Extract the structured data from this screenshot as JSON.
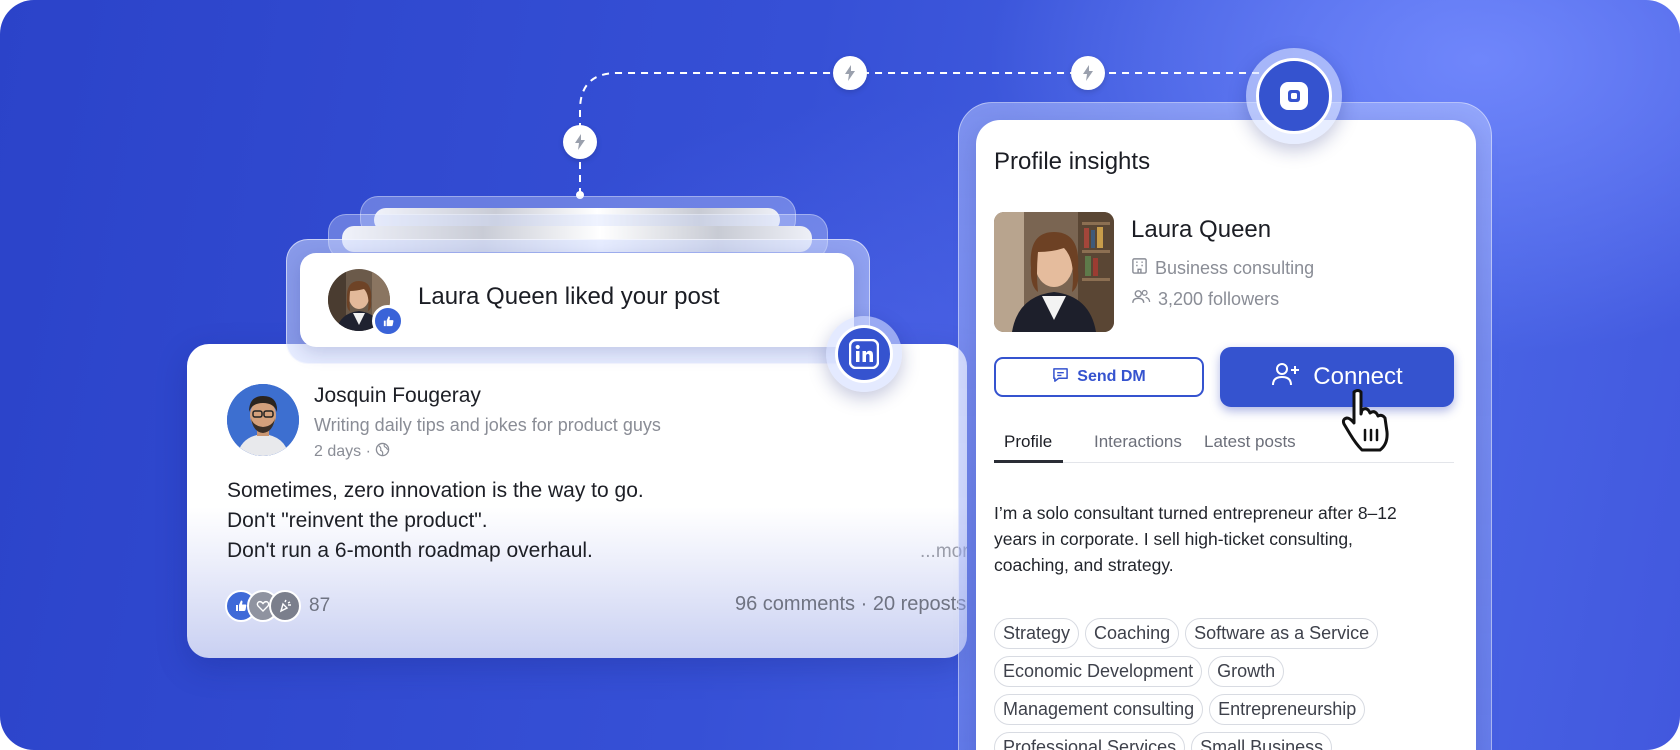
{
  "notification": {
    "text": "Laura Queen liked your post",
    "avatar": "laura-queen-avatar",
    "badge_icon": "thumbs-up-icon"
  },
  "post": {
    "author": "Josquin Fougeray",
    "headline": "Writing daily tips and jokes for product guys",
    "time": "2 days ·",
    "time_icon": "globe-icon",
    "lines": [
      "Sometimes, zero innovation is the way to go.",
      "Don't \"reinvent the product\".",
      "Don't run a 6-month roadmap overhaul."
    ],
    "more": "...more",
    "reaction_count": "87",
    "stats": "96 comments · 20 reposts"
  },
  "profile": {
    "panel_title": "Profile insights",
    "name": "Laura Queen",
    "industry": "Business consulting",
    "followers": "3,200 followers",
    "send_dm_label": "Send DM",
    "connect_label": "Connect",
    "tabs": [
      {
        "label": "Profile"
      },
      {
        "label": "Interactions"
      },
      {
        "label": "Latest posts"
      }
    ],
    "about": "I’m a solo consultant turned entrepreneur after 8–12 years in corporate. I sell high-ticket consulting, coaching, and strategy.",
    "tags": [
      "Strategy",
      "Coaching",
      "Software as a Service",
      "Economic Development",
      "Growth",
      "Management consulting",
      "Entrepreneurship",
      "Professional Services",
      "Small Business"
    ]
  },
  "colors": {
    "brand_blue": "#3553cf",
    "background": "#3650d6"
  }
}
